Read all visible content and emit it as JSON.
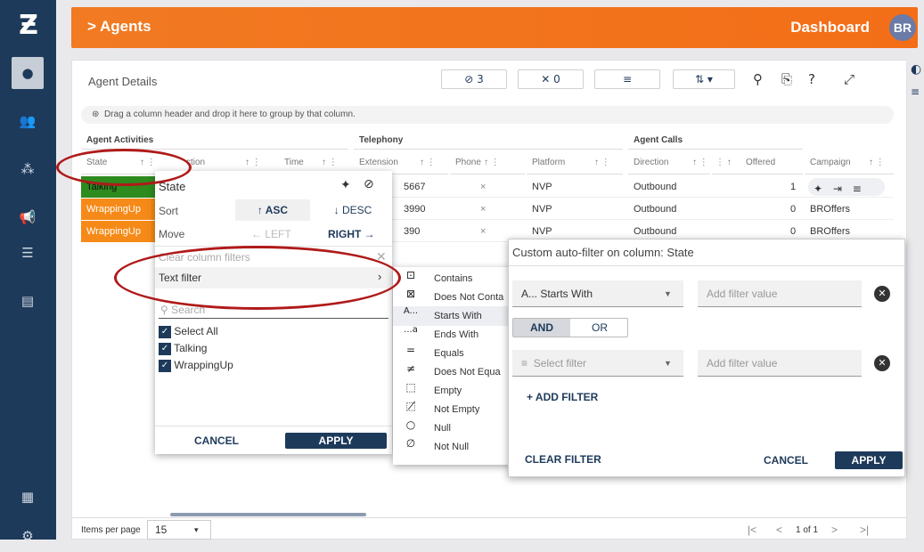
{
  "header": {
    "breadcrumb": "> Agents",
    "dashboard": "Dashboard",
    "avatar_initials": "BR"
  },
  "panel": {
    "title": "Agent Details",
    "toolbar": {
      "hidden_count": "3",
      "pinned_count": "0"
    },
    "group_hint": "Drag a column header and drop it here to group by that column."
  },
  "grid": {
    "group_headers": [
      "Agent Activities",
      "Telephony",
      "Agent Calls"
    ],
    "columns": [
      "State",
      "ction",
      "Time",
      "Extension",
      "Phone",
      "Platform",
      "Direction",
      "Offered",
      "Campaign"
    ],
    "rows": [
      {
        "state": "Talking",
        "ext": "5667",
        "phone": "×",
        "platform": "NVP",
        "direction": "Outbound",
        "offered": "1",
        "campaign": ""
      },
      {
        "state": "WrappingUp",
        "ext": "3990",
        "phone": "×",
        "platform": "NVP",
        "direction": "Outbound",
        "offered": "0",
        "campaign": "BROffers"
      },
      {
        "state": "WrappingUp",
        "ext": "390",
        "phone": "×",
        "platform": "NVP",
        "direction": "Outbound",
        "offered": "0",
        "campaign": "BROffers"
      }
    ]
  },
  "column_menu": {
    "title": "State",
    "sort_label": "Sort",
    "asc": "↑ ASC",
    "desc": "↓ DESC",
    "move_label": "Move",
    "left": "← LEFT",
    "right": "RIGHT →",
    "clear_filters": "Clear column filters",
    "text_filter": "Text filter",
    "search_placeholder": "Search",
    "values": [
      "Select All",
      "Talking",
      "WrappingUp"
    ],
    "cancel": "CANCEL",
    "apply": "APPLY"
  },
  "text_filter_menu": {
    "items": [
      {
        "glyph": "⊡",
        "label": "Contains"
      },
      {
        "glyph": "⊠",
        "label": "Does Not Conta"
      },
      {
        "glyph": "A...",
        "label": "Starts With"
      },
      {
        "glyph": "...a",
        "label": "Ends With"
      },
      {
        "glyph": "=",
        "label": "Equals"
      },
      {
        "glyph": "≠",
        "label": "Does Not Equa"
      },
      {
        "glyph": "⬚",
        "label": "Empty"
      },
      {
        "glyph": "⬚̸",
        "label": "Not Empty"
      },
      {
        "glyph": "○",
        "label": "Null"
      },
      {
        "glyph": "∅",
        "label": "Not Null"
      }
    ]
  },
  "custom_filter": {
    "title": "Custom auto-filter on column: State",
    "op1": "A...  Starts With",
    "value_placeholder": "Add filter value",
    "and": "AND",
    "or": "OR",
    "op2_placeholder": "Select filter",
    "add_filter": "+ ADD FILTER",
    "clear_filter": "CLEAR FILTER",
    "cancel": "CANCEL",
    "apply": "APPLY"
  },
  "footer": {
    "items_per_page_label": "Items per page",
    "items_per_page": "15",
    "page_info": "1 of 1"
  },
  "colors": {
    "accent": "#f37021",
    "navy": "#1e3a5a",
    "talking": "#2e8b1e",
    "wrapping": "#f68a18",
    "annotation": "#b01a1a"
  }
}
